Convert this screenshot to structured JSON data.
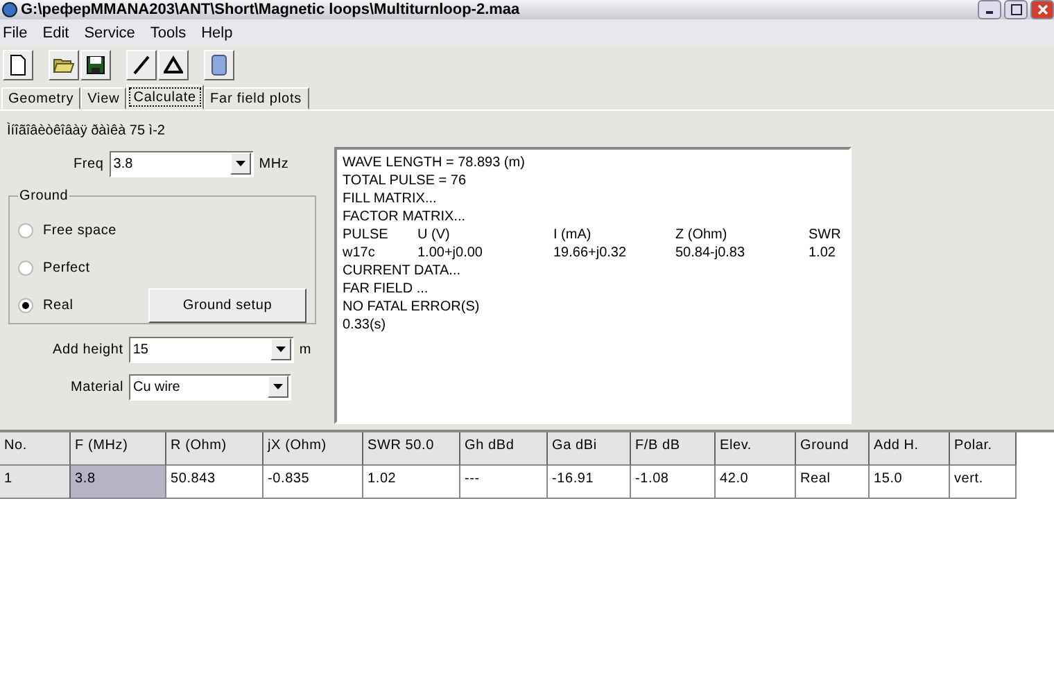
{
  "window": {
    "title": "G:\\реферMMANA203\\ANT\\Short\\Magnetic loops\\Multiturnloop-2.maa"
  },
  "menu": [
    "File",
    "Edit",
    "Service",
    "Tools",
    "Help"
  ],
  "tabs": [
    {
      "label": "Geometry",
      "selected": false
    },
    {
      "label": "View",
      "selected": false
    },
    {
      "label": "Calculate",
      "selected": true
    },
    {
      "label": "Far field plots",
      "selected": false
    }
  ],
  "comment": "Ìíîãîâèòêîâàÿ ðàìêà 75 ì-2",
  "freq": {
    "label": "Freq",
    "value": "3.8",
    "unit": "MHz"
  },
  "ground": {
    "title": "Ground",
    "options": [
      {
        "label": "Free space",
        "selected": false
      },
      {
        "label": "Perfect",
        "selected": false
      },
      {
        "label": "Real",
        "selected": true
      }
    ],
    "setup_button": "Ground setup"
  },
  "add_height": {
    "label": "Add height",
    "value": "15",
    "unit": "m"
  },
  "material": {
    "label": "Material",
    "value": "Cu wire"
  },
  "output": [
    {
      "kind": "text",
      "text": "WAVE LENGTH = 78.893 (m)"
    },
    {
      "kind": "text",
      "text": "TOTAL PULSE = 76"
    },
    {
      "kind": "text",
      "text": "FILL MATRIX..."
    },
    {
      "kind": "text",
      "text": "FACTOR MATRIX..."
    },
    {
      "kind": "columns",
      "cells": [
        "PULSE",
        "U (V)",
        "I (mA)",
        "Z (Ohm)",
        "SWR"
      ]
    },
    {
      "kind": "columns",
      "cells": [
        "w17c",
        "1.00+j0.00",
        "19.66+j0.32",
        "50.84-j0.83",
        "1.02"
      ]
    },
    {
      "kind": "text",
      "text": "CURRENT DATA..."
    },
    {
      "kind": "text",
      "text": "FAR FIELD ..."
    },
    {
      "kind": "text",
      "text": "NO FATAL ERROR(S)"
    },
    {
      "kind": "text",
      "text": "0.33(s)"
    }
  ],
  "table": {
    "columns": [
      "No.",
      "F (MHz)",
      "R (Ohm)",
      "jX (Ohm)",
      "SWR 50.0",
      "Gh dBd",
      "Ga dBi",
      "F/B dB",
      "Elev.",
      "Ground",
      "Add H.",
      "Polar."
    ],
    "rows": [
      {
        "cells": [
          {
            "text": "1",
            "selected": false
          },
          {
            "text": "3.8",
            "selected": true
          },
          {
            "text": "50.843",
            "selected": false
          },
          {
            "text": "-0.835",
            "selected": false
          },
          {
            "text": "1.02",
            "selected": false
          },
          {
            "text": "---",
            "selected": false
          },
          {
            "text": "-16.91",
            "selected": false
          },
          {
            "text": "-1.08",
            "selected": false
          },
          {
            "text": "42.0",
            "selected": false
          },
          {
            "text": "Real",
            "selected": false
          },
          {
            "text": "15.0",
            "selected": false
          },
          {
            "text": "vert.",
            "selected": false
          }
        ]
      }
    ]
  }
}
